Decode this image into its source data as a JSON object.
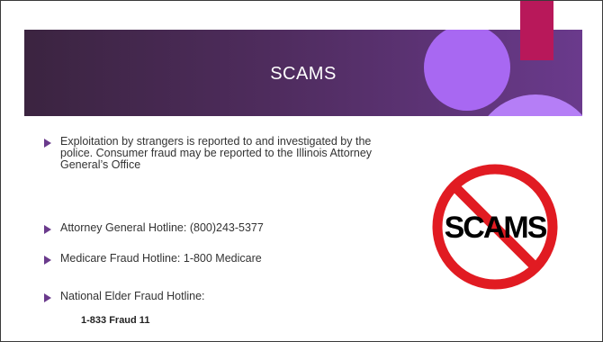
{
  "slide": {
    "title": "SCAMS",
    "bullets": [
      {
        "text": "Exploitation by strangers is reported to and investigated by the police. Consumer fraud may be reported to the Illinois Attorney General’s Office"
      },
      {
        "text": "Attorney General Hotline: (800)243-5377"
      },
      {
        "text": "Medicare Fraud Hotline: 1-800 Medicare"
      },
      {
        "text": "National Elder Fraud Hotline:",
        "sub": "1-833 Fraud 11"
      }
    ],
    "sign_text": "SCAMS",
    "colors": {
      "banner_dark": "#3b2440",
      "banner_light": "#6a3a8c",
      "accent_pink": "#b8185a",
      "circle_purple": "#a868f2",
      "prohibit_red": "#e11b22",
      "bullet_arrow": "#6a3a8c"
    }
  }
}
